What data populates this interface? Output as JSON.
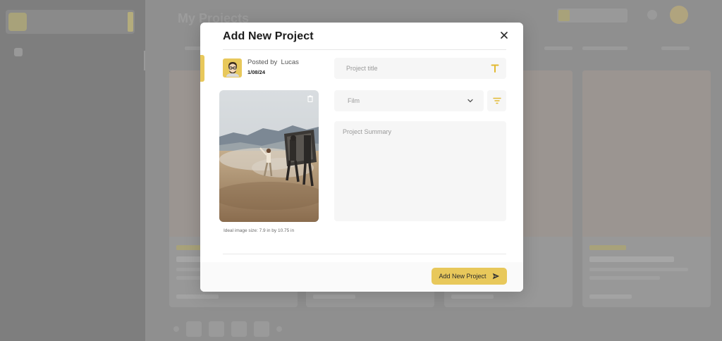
{
  "background": {
    "page_title": "My Projects"
  },
  "modal": {
    "title": "Add New Project",
    "close_label": "×",
    "poster": {
      "posted_by_label": "Posted by",
      "name": "Lucas",
      "date": "1/08/24"
    },
    "image_hint": "Ideal image size: 7.9 in by 10.75 in",
    "title_field": {
      "placeholder": "Project title",
      "value": ""
    },
    "category_select": {
      "selected": "Film"
    },
    "summary_field": {
      "placeholder": "Project Summary",
      "value": ""
    },
    "submit_label": "Add New Project"
  },
  "colors": {
    "accent": "#e8c85b",
    "field_bg": "#f6f6f6",
    "overlay_bg": "#8d8d8d"
  },
  "icons": {
    "close": "close-icon",
    "title_field": "text-format-icon",
    "category_chevron": "chevron-down-icon",
    "filter": "filter-icon",
    "delete_image": "trash-icon",
    "submit": "send-icon"
  }
}
